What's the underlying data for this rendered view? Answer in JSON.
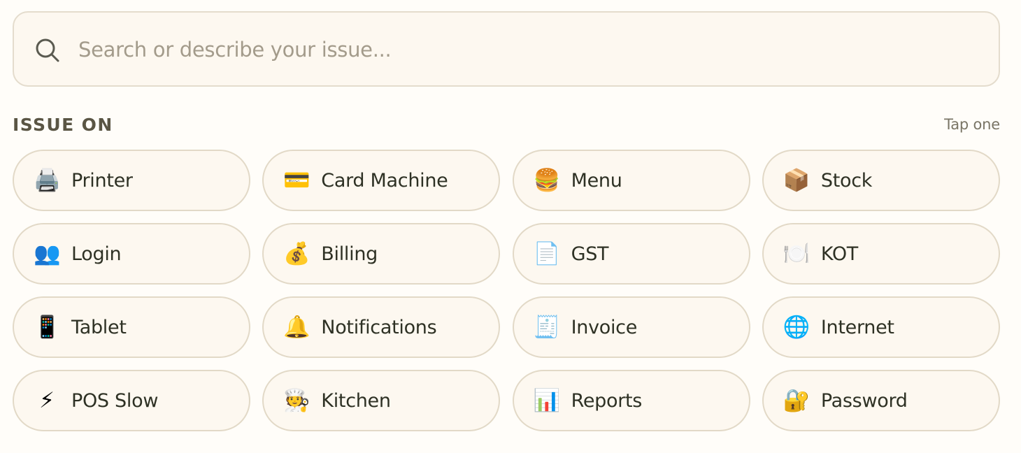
{
  "search": {
    "placeholder": "Search or describe your issue...",
    "value": ""
  },
  "section": {
    "title": "ISSUE ON",
    "hint": "Tap one"
  },
  "issues": [
    {
      "label": "Printer",
      "icon": "printer-icon",
      "glyph": "🖨️"
    },
    {
      "label": "Card Machine",
      "icon": "credit-card-icon",
      "glyph": "💳"
    },
    {
      "label": "Menu",
      "icon": "burger-icon",
      "glyph": "🍔"
    },
    {
      "label": "Stock",
      "icon": "package-icon",
      "glyph": "📦"
    },
    {
      "label": "Login",
      "icon": "users-icon",
      "glyph": "👥"
    },
    {
      "label": "Billing",
      "icon": "money-bag-icon",
      "glyph": "💰"
    },
    {
      "label": "GST",
      "icon": "document-icon",
      "glyph": "📄"
    },
    {
      "label": "KOT",
      "icon": "plate-cutlery-icon",
      "glyph": "🍽️"
    },
    {
      "label": "Tablet",
      "icon": "mobile-phone-icon",
      "glyph": "📱"
    },
    {
      "label": "Notifications",
      "icon": "bell-icon",
      "glyph": "🔔"
    },
    {
      "label": "Invoice",
      "icon": "receipt-icon",
      "glyph": "🧾"
    },
    {
      "label": "Internet",
      "icon": "globe-icon",
      "glyph": "🌐"
    },
    {
      "label": "POS Slow",
      "icon": "lightning-icon",
      "glyph": "⚡"
    },
    {
      "label": "Kitchen",
      "icon": "cook-icon",
      "glyph": "🧑‍🍳"
    },
    {
      "label": "Reports",
      "icon": "bar-chart-icon",
      "glyph": "📊"
    },
    {
      "label": "Password",
      "icon": "lock-key-icon",
      "glyph": "🔐"
    }
  ],
  "colors": {
    "background": "#fffdf9",
    "surface": "#fdf8f0",
    "border": "#e2d9c7",
    "text": "#2e3124",
    "muted": "#a39b8b",
    "heading": "#5a5544"
  }
}
